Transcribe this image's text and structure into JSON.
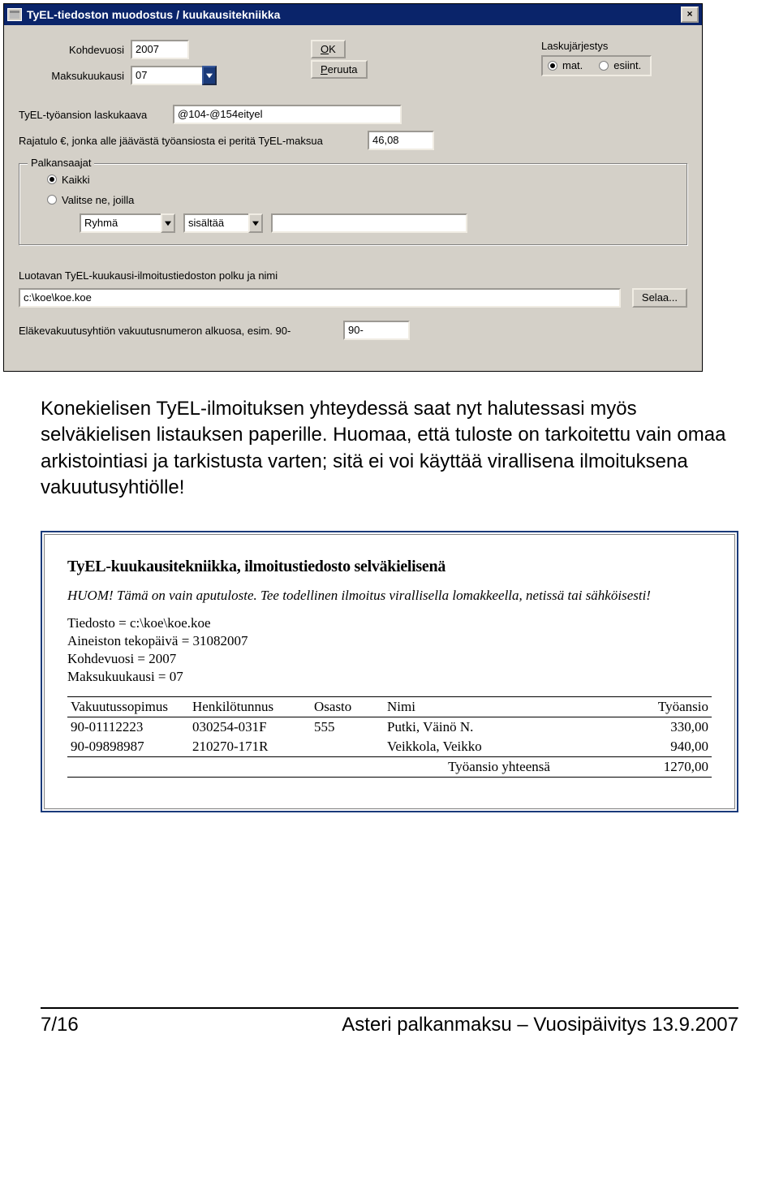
{
  "dialog": {
    "title": "TyEL-tiedoston muodostus / kuukausitekniikka",
    "kohdevuosi_label": "Kohdevuosi",
    "kohdevuosi_value": "2007",
    "maksukuukausi_label": "Maksukuukausi",
    "maksukuukausi_value": "07",
    "ok_label": "OK",
    "cancel_label": "Peruuta",
    "laskujarjestys_label": "Laskujärjestys",
    "laskujarjestys_opt1": "mat.",
    "laskujarjestys_opt2": "esiint.",
    "laskujarjestys_sel": "mat.",
    "kaava_label": "TyEL-työansion laskukaava",
    "kaava_value": "@104-@154eityel",
    "rajatulo_label": "Rajatulo €, jonka alle jäävästä työansiosta ei peritä TyEL-maksua",
    "rajatulo_value": "46,08",
    "palkansaajat_legend": "Palkansaajat",
    "palkansaajat_opt_all": "Kaikki",
    "palkansaajat_opt_sel": "Valitse ne, joilla",
    "filter_field_value": "Ryhmä",
    "filter_op_value": "sisältää",
    "filter_val_value": "",
    "path_label": "Luotavan TyEL-kuukausi-ilmoitustiedoston polku ja nimi",
    "path_value": "c:\\koe\\koe.koe",
    "browse_label": "Selaa...",
    "vaknum_label": "Eläkevakuutusyhtiön vakuutusnumeron alkuosa, esim. 90-",
    "vaknum_value": "90-"
  },
  "paragraph": "Konekielisen TyEL-ilmoituksen yhteydessä saat nyt halutessasi myös selväkielisen listauksen paperille. Huomaa, että tuloste on tarkoitettu vain omaa arkistointiasi ja tarkistusta varten; sitä ei voi käyttää virallisena ilmoituksena vakuutusyhtiölle!",
  "report": {
    "title": "TyEL-kuukausitekniikka, ilmoitustiedosto selväkielisenä",
    "note": "HUOM! Tämä on vain aputuloste. Tee todellinen ilmoitus virallisella lomakkeella, netissä tai sähköisesti!",
    "meta": [
      "Tiedosto = c:\\koe\\koe.koe",
      "Aineiston tekopäivä = 31082007",
      "Kohdevuosi = 2007",
      "Maksukuukausi = 07"
    ],
    "columns": [
      "Vakuutussopimus",
      "Henkilötunnus",
      "Osasto",
      "Nimi",
      "Työansio"
    ],
    "rows": [
      {
        "sop": "90-01112223",
        "ht": "030254-031F",
        "os": "555",
        "nimi": "Putki, Väinö N.",
        "ans": "330,00"
      },
      {
        "sop": "90-09898987",
        "ht": "210270-171R",
        "os": "",
        "nimi": "Veikkola, Veikko",
        "ans": "940,00"
      }
    ],
    "total_label": "Työansio yhteensä",
    "total_value": "1270,00"
  },
  "footer": {
    "left": "7/16",
    "right": "Asteri palkanmaksu – Vuosipäivitys 13.9.2007"
  }
}
